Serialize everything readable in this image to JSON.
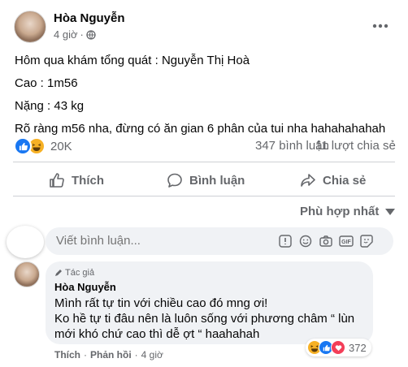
{
  "post": {
    "author": "Hòa Nguyễn",
    "time": "4 giờ",
    "privacy_icon": "globe-icon",
    "menu_icon": "more-icon",
    "lines": [
      "Hôm qua khám tổng quát : Nguyễn Thị Hoà",
      "Cao : 1m56",
      "Nặng : 43 kg",
      "Rõ ràng m56 nha, đừng có ăn gian 6 phân của tui nha hahahahahah"
    ]
  },
  "stats": {
    "reactions": "20K",
    "comments": "347 bình luận",
    "shares": "11 lượt chia sẻ"
  },
  "actions": {
    "like": "Thích",
    "comment": "Bình luận",
    "share": "Chia sẻ"
  },
  "sort": {
    "label": "Phù hợp nhất"
  },
  "composer": {
    "placeholder": "Viết bình luận..."
  },
  "comment": {
    "badge": "Tác giả",
    "author": "Hòa Nguyễn",
    "lines": [
      "Mình rất tự tin với chiều cao đó mng ơi!",
      "Ko hề tự ti đâu nên là luôn sống với phương châm “ lùn",
      "mới khó chứ cao thì dễ ợt “ haahahah"
    ],
    "like": "Thích",
    "reply": "Phản hồi",
    "time": "4 giờ",
    "reaction_count": "372"
  },
  "colors": {
    "like_blue": "#1877f2",
    "haha_yellow": "#f7b125",
    "love_red": "#f33e58",
    "grey_text": "#65676b",
    "bubble_bg": "#f0f2f5"
  }
}
